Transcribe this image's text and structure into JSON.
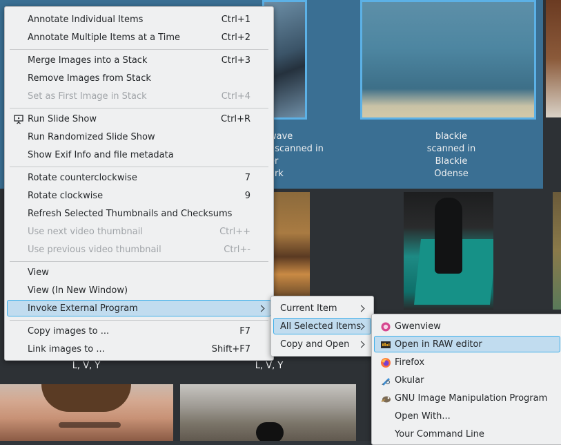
{
  "background": {
    "captions": [
      {
        "lines": [
          "wave",
          ", scanned in",
          "er",
          "ark"
        ]
      },
      {
        "lines": [
          "blackie",
          "scanned in",
          "Blackie",
          "Odense"
        ]
      },
      {
        "lines": [
          "L, V, Y"
        ]
      },
      {
        "lines": [
          "L, V, Y"
        ]
      }
    ]
  },
  "context_menu": {
    "items": [
      {
        "label": "Annotate Individual Items",
        "shortcut": "Ctrl+1"
      },
      {
        "label": "Annotate Multiple Items at a Time",
        "shortcut": "Ctrl+2"
      },
      {
        "label": "Merge Images into a Stack",
        "shortcut": "Ctrl+3"
      },
      {
        "label": "Remove Images from Stack",
        "shortcut": ""
      },
      {
        "label": "Set as First Image in Stack",
        "shortcut": "Ctrl+4"
      },
      {
        "label": "Run Slide Show",
        "shortcut": "Ctrl+R"
      },
      {
        "label": "Run Randomized Slide Show",
        "shortcut": ""
      },
      {
        "label": "Show Exif Info and file metadata",
        "shortcut": ""
      },
      {
        "label": "Rotate counterclockwise",
        "shortcut": "7"
      },
      {
        "label": "Rotate clockwise",
        "shortcut": "9"
      },
      {
        "label": "Refresh Selected Thumbnails and Checksums",
        "shortcut": ""
      },
      {
        "label": "Use next video thumbnail",
        "shortcut": "Ctrl++"
      },
      {
        "label": "Use previous video thumbnail",
        "shortcut": "Ctrl+-"
      },
      {
        "label": "View",
        "shortcut": ""
      },
      {
        "label": "View (In New Window)",
        "shortcut": ""
      },
      {
        "label": "Invoke External Program",
        "shortcut": ""
      },
      {
        "label": "Copy images to ...",
        "shortcut": "F7"
      },
      {
        "label": "Link images to ...",
        "shortcut": "Shift+F7"
      }
    ]
  },
  "external_submenu": {
    "items": [
      {
        "label": "Current Item"
      },
      {
        "label": "All Selected Items"
      },
      {
        "label": "Copy and Open"
      }
    ]
  },
  "apps_submenu": {
    "items": [
      {
        "label": "Gwenview",
        "icon": "gwenview-icon"
      },
      {
        "label": "Open in RAW editor",
        "icon": "raw-editor-icon"
      },
      {
        "label": "Firefox",
        "icon": "firefox-icon"
      },
      {
        "label": "Okular",
        "icon": "okular-icon"
      },
      {
        "label": "GNU Image Manipulation Program",
        "icon": "gimp-icon"
      },
      {
        "label": "Open With...",
        "icon": ""
      },
      {
        "label": "Your Command Line",
        "icon": ""
      }
    ]
  },
  "colors": {
    "highlight_bg": "#c1dcef",
    "highlight_border": "#3daee9",
    "menu_bg": "#eff0f1",
    "selection_band": "#3a6f93"
  }
}
